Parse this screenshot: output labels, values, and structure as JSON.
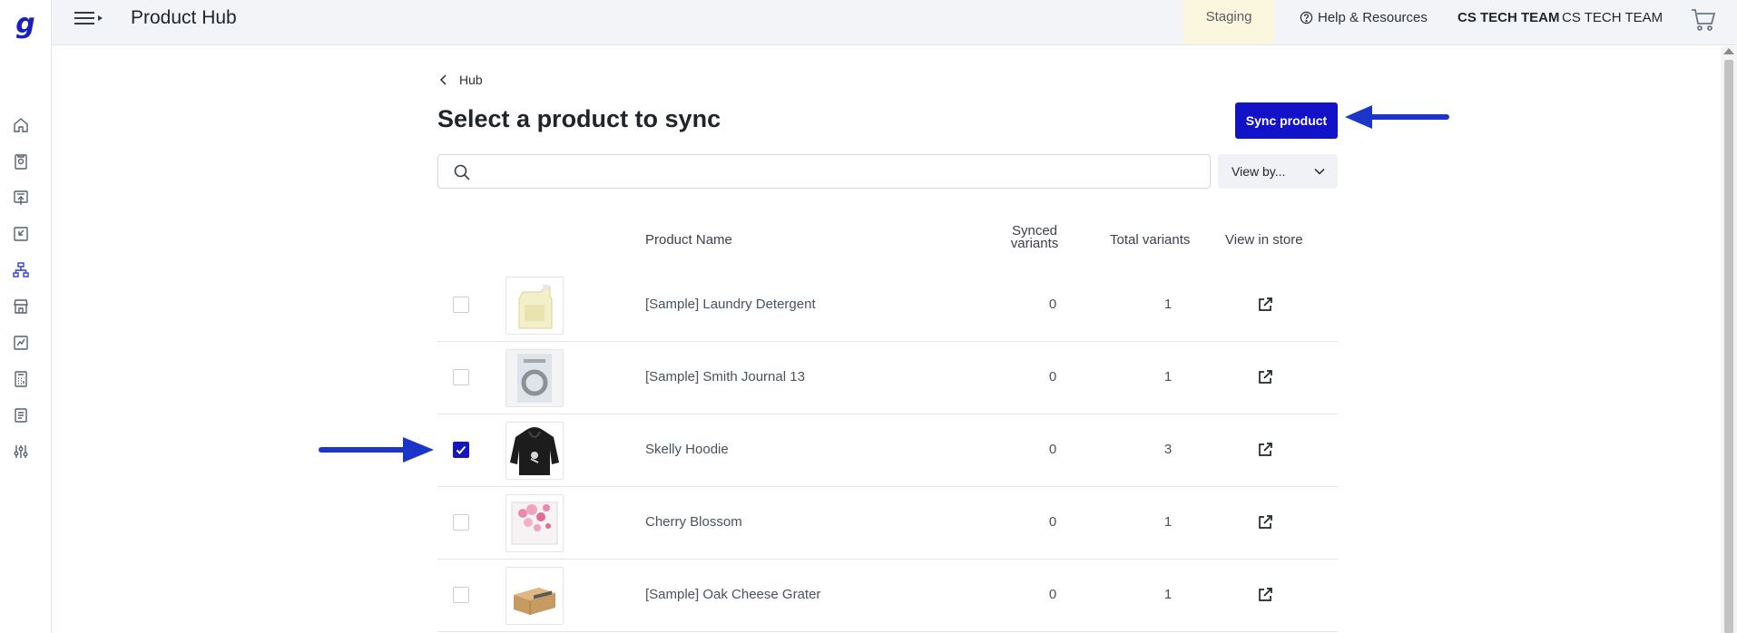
{
  "topbar": {
    "app_title": "Product Hub",
    "environment": "Staging",
    "help_label": "Help & Resources",
    "team_bold": "CS TECH TEAM",
    "team": "CS TECH TEAM"
  },
  "logo_letter": "g",
  "breadcrumb": {
    "label": "Hub"
  },
  "page": {
    "title": "Select a product to sync",
    "sync_button": "Sync product"
  },
  "search": {
    "value": "",
    "placeholder": ""
  },
  "view_by": {
    "label": "View by..."
  },
  "table": {
    "headers": {
      "product_name": "Product Name",
      "synced_line1": "Synced",
      "synced_line2": "variants",
      "total": "Total variants",
      "view_store": "View in store"
    },
    "rows": [
      {
        "name": "[Sample] Laundry Detergent",
        "synced": "0",
        "total": "1",
        "checked": false,
        "thumb": "detergent-jug"
      },
      {
        "name": "[Sample] Smith Journal 13",
        "synced": "0",
        "total": "1",
        "checked": false,
        "thumb": "journal-cover"
      },
      {
        "name": "Skelly Hoodie",
        "synced": "0",
        "total": "3",
        "checked": true,
        "thumb": "black-hoodie"
      },
      {
        "name": "Cherry Blossom",
        "synced": "0",
        "total": "1",
        "checked": false,
        "thumb": "cherry-blossom-canvas"
      },
      {
        "name": "[Sample] Oak Cheese Grater",
        "synced": "0",
        "total": "1",
        "checked": false,
        "thumb": "cheese-grater"
      }
    ]
  },
  "colors": {
    "primary": "#1212c9",
    "annotation_arrow": "#1a35c8",
    "staging_bg": "#fbf6de",
    "rail_active": "#2c3fd6"
  }
}
